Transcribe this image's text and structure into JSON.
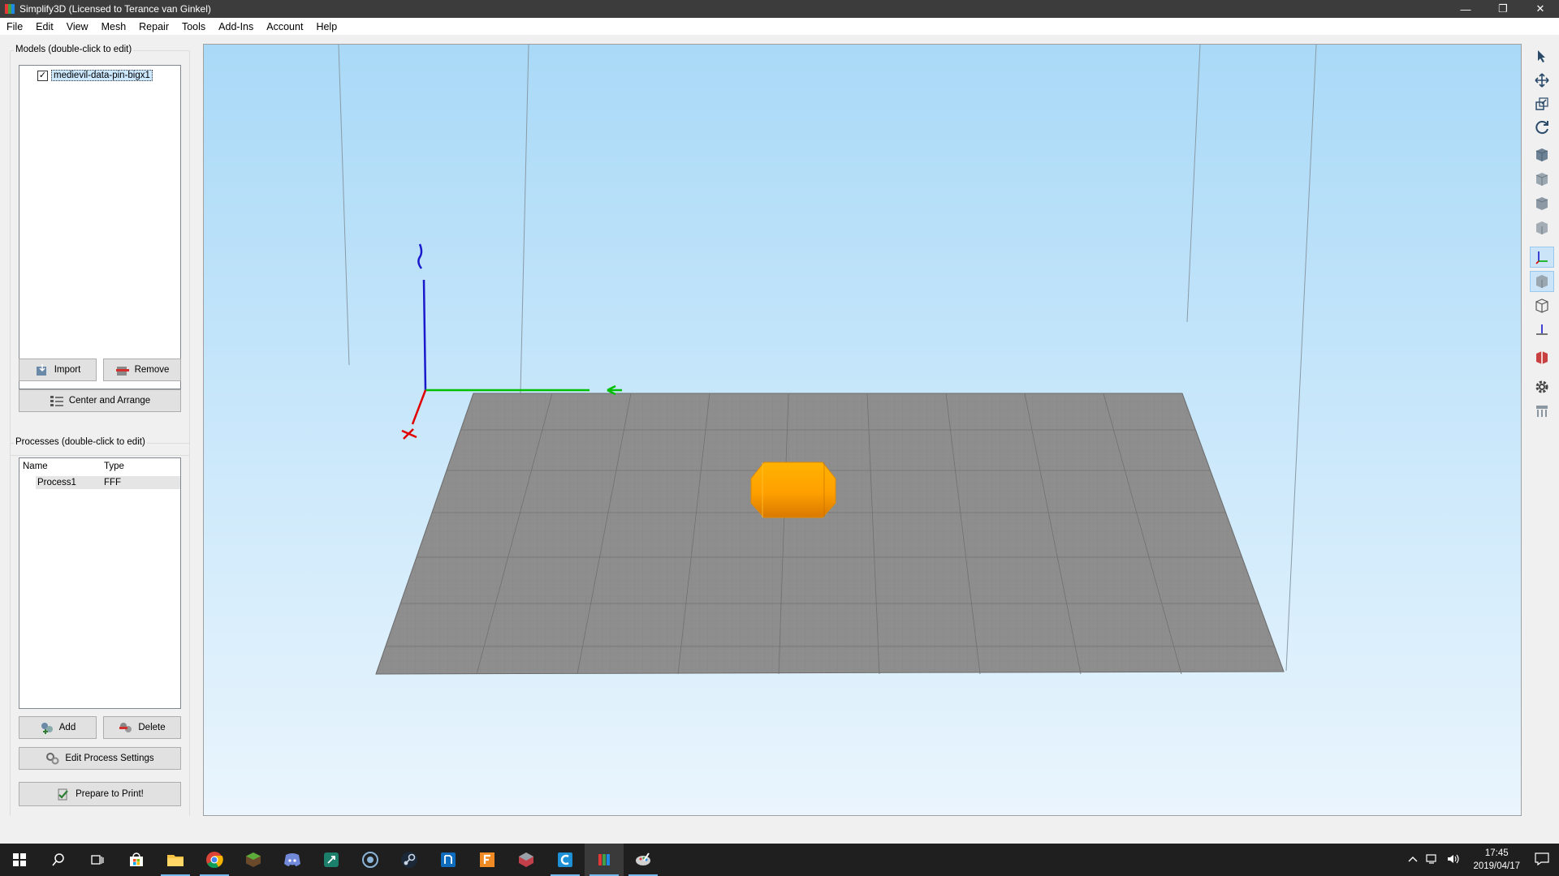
{
  "window": {
    "title": "Simplify3D (Licensed to Terance van Ginkel)"
  },
  "menu": [
    "File",
    "Edit",
    "View",
    "Mesh",
    "Repair",
    "Tools",
    "Add-Ins",
    "Account",
    "Help"
  ],
  "models": {
    "group_title": "Models (double-click to edit)",
    "items": [
      {
        "name": "medievil-data-pin-bigx1",
        "checked": true
      }
    ],
    "import_label": "Import",
    "remove_label": "Remove",
    "center_label": "Center and Arrange"
  },
  "processes": {
    "group_title": "Processes (double-click to edit)",
    "columns": [
      "Name",
      "Type"
    ],
    "rows": [
      {
        "name": "Process1",
        "type": "FFF"
      }
    ],
    "add_label": "Add",
    "delete_label": "Delete",
    "edit_label": "Edit Process Settings",
    "prepare_label": "Prepare to Print!"
  },
  "right_toolbar": [
    "select-icon",
    "move-icon",
    "scale-icon",
    "rotate-icon",
    "view-default-icon",
    "view-front-icon",
    "view-side-icon",
    "view-top-icon",
    "axes-toggle-icon",
    "solid-view-icon",
    "wireframe-view-icon",
    "build-table-icon",
    "cross-section-icon",
    "settings-icon",
    "supports-icon"
  ],
  "taskbar": {
    "apps": [
      "windows-start-icon",
      "search-icon",
      "task-view-icon",
      "store-icon",
      "file-explorer-icon",
      "chrome-icon",
      "minecraft-icon",
      "discord-icon",
      "app-icon",
      "app-icon",
      "steam-icon",
      "app-icon",
      "fusion-icon",
      "app-icon",
      "cura-icon",
      "simplify3d-icon",
      "app-icon"
    ],
    "time": "17:45",
    "date": "2019/04/17"
  },
  "colors": {
    "accent": "#76b9ed",
    "model": "#ffab00",
    "bed": "#8c8c8c",
    "x_axis": "#e00000",
    "y_axis": "#00c000",
    "z_axis": "#0000c0"
  }
}
